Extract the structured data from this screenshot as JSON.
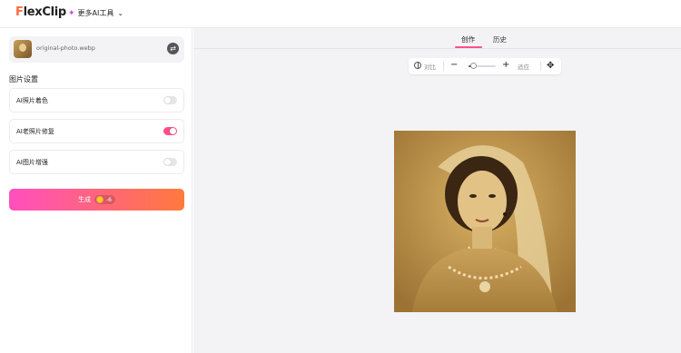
{
  "header": {
    "logo_mark": "F",
    "logo_text": "lexClip",
    "more_tools_label": "更多AI工具",
    "more_tools_icon": "sparkle-icon",
    "chevron_icon": "chevron-down-icon"
  },
  "left_panel": {
    "file": {
      "name": "original-photo.webp",
      "thumb_icon": "photo-thumbnail",
      "swap_icon": "swap-icon"
    },
    "section_title": "图片设置",
    "options": [
      {
        "label": "AI照片着色",
        "enabled": false
      },
      {
        "label": "AI老照片修复",
        "enabled": true
      },
      {
        "label": "AI图片增强",
        "enabled": false
      }
    ],
    "generate": {
      "label": "生成",
      "credit_cost": "-6",
      "coin_icon": "coin-icon"
    }
  },
  "main": {
    "tabs": [
      {
        "label": "创作",
        "active": true
      },
      {
        "label": "历史",
        "active": false
      }
    ],
    "toolbar": {
      "compare_label": "对比",
      "compare_icon": "compare-icon",
      "zoom_minus": "−",
      "zoom_plus": "+",
      "zoom_level": 0.15,
      "fit_label": "适应",
      "move_icon": "move-icon",
      "move_glyph": "✥"
    },
    "photo_alt": "vintage sepia portrait"
  },
  "colors": {
    "accent_pink": "#ff4f8b",
    "gradient_start": "#ff4fbf",
    "gradient_end": "#ff7a3c",
    "logo_orange": "#ff6a3d",
    "canvas_bg": "#f3f3f6"
  }
}
